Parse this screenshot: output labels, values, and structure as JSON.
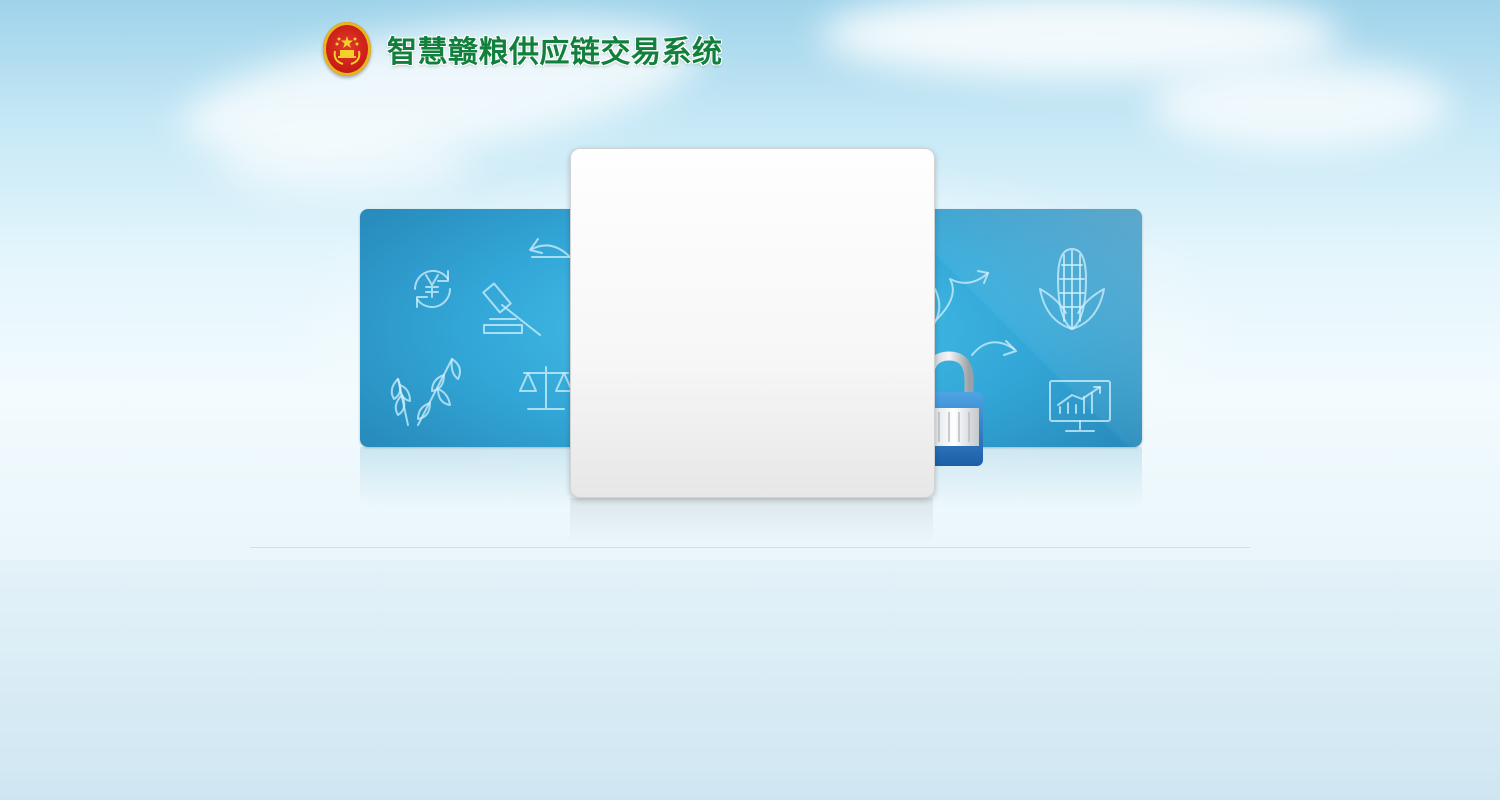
{
  "app": {
    "title": "智慧赣粮供应链交易系统"
  },
  "header": {
    "emblem_icon": "national-emblem-icon"
  },
  "banner": {
    "icons": [
      "yuan-exchange-icon",
      "return-arrow-icon",
      "gavel-icon",
      "wheat-icon",
      "scale-icon",
      "trend-arrow-icon",
      "corn-icon",
      "curved-arrow-icon",
      "chart-monitor-icon",
      "padlock-icon"
    ]
  },
  "colors": {
    "title_green": "#11803c",
    "banner_blue": "#33a8d8",
    "emblem_red": "#c91d16",
    "emblem_gold": "#e6b520"
  }
}
